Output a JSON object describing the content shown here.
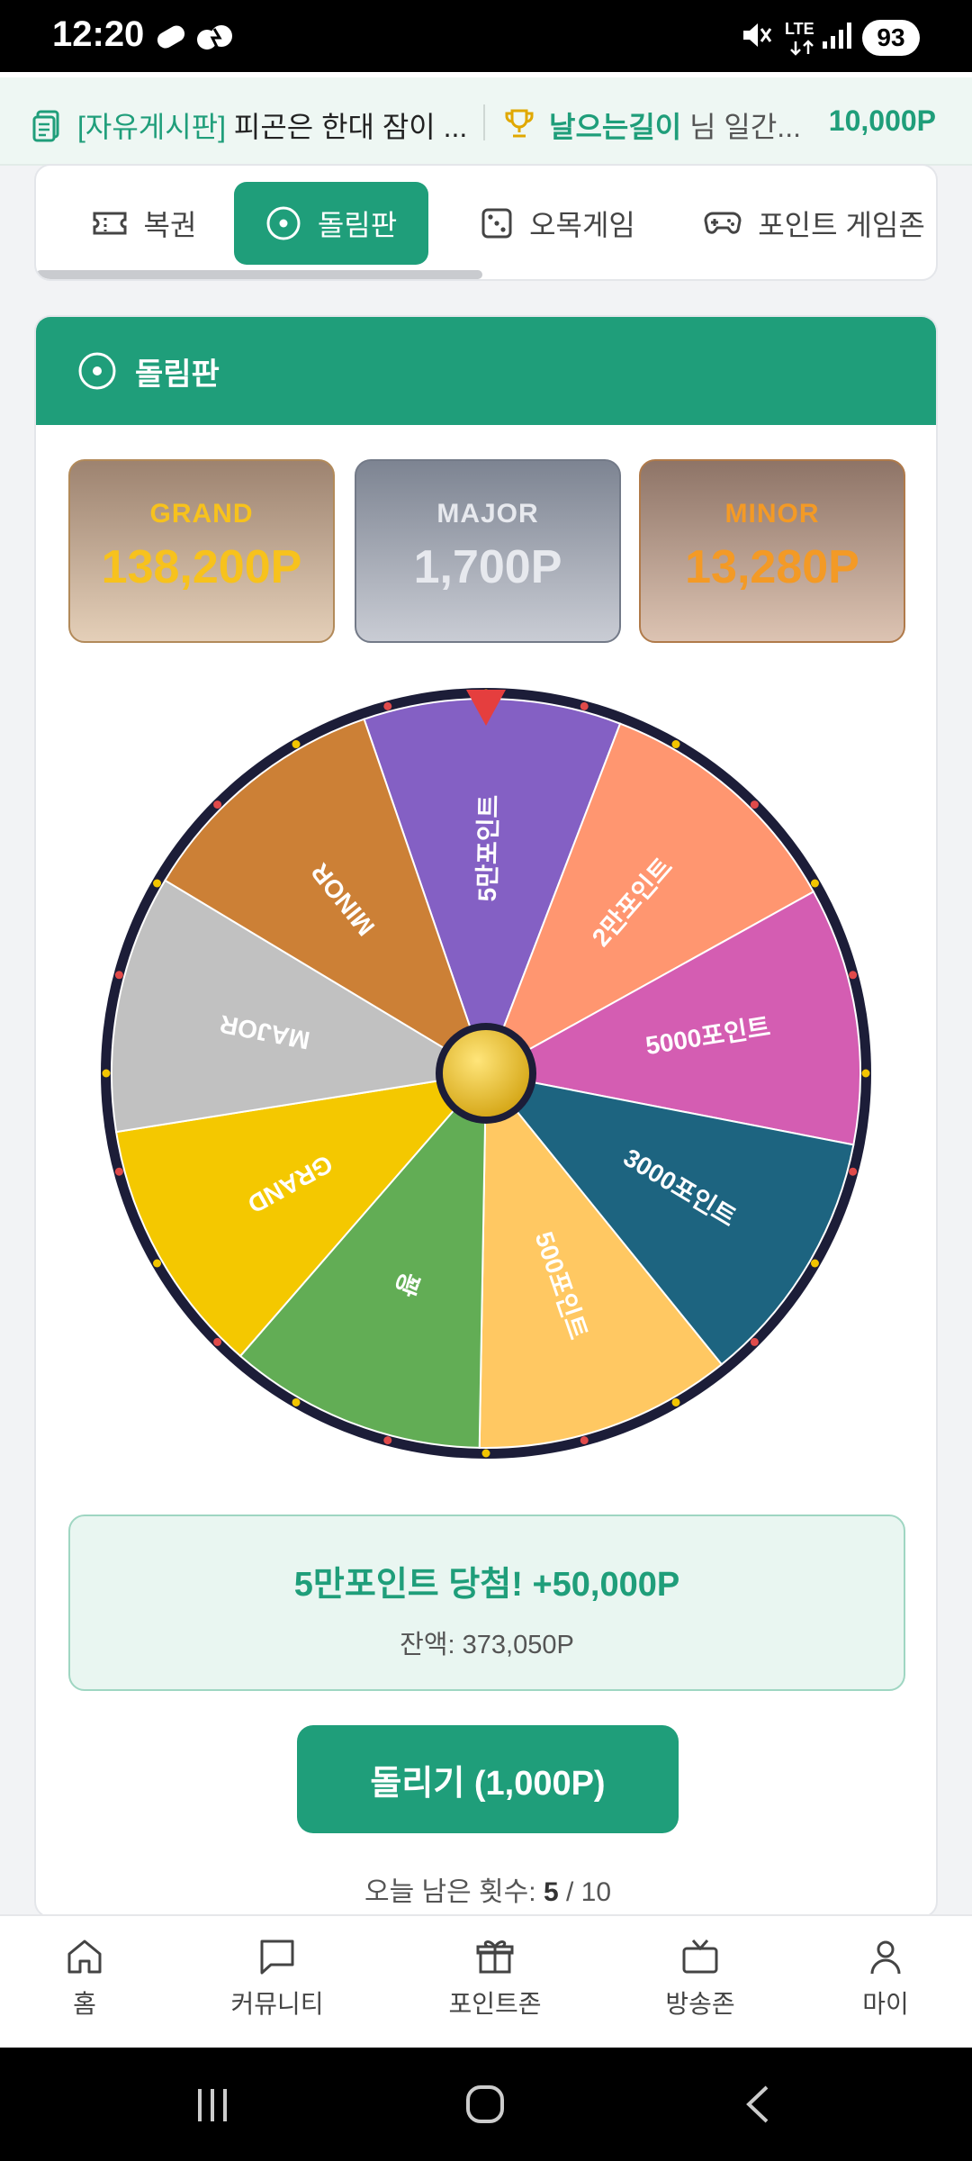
{
  "status": {
    "time": "12:20",
    "battery": "93",
    "network": "LTE"
  },
  "ticker": {
    "board": "[자유게시판]",
    "post": "피곤은 한대 잠이 ...",
    "nickname": "날으는길이",
    "suffix": "님 일간...",
    "points": "10,000P"
  },
  "tabs": [
    {
      "label": "복권",
      "icon": "ticket-icon",
      "active": false
    },
    {
      "label": "돌림판",
      "icon": "target-icon",
      "active": true
    },
    {
      "label": "오목게임",
      "icon": "dice-icon",
      "active": false
    },
    {
      "label": "포인트 게임존",
      "icon": "gamepad-icon",
      "active": false
    }
  ],
  "card": {
    "title": "돌림판"
  },
  "jackpots": [
    {
      "label": "GRAND",
      "value": "138,200P"
    },
    {
      "label": "MAJOR",
      "value": "1,700P"
    },
    {
      "label": "MINOR",
      "value": "13,280P"
    }
  ],
  "wheel": {
    "segments": [
      {
        "label": "5만포인트",
        "color": "#8460c4"
      },
      {
        "label": "2만포인트",
        "color": "#ff9670"
      },
      {
        "label": "5000포인트",
        "color": "#d45db2"
      },
      {
        "label": "3000포인트",
        "color": "#1d6480"
      },
      {
        "label": "500포인트",
        "color": "#ffc862"
      },
      {
        "label": "꽝",
        "color": "#62ad55"
      },
      {
        "label": "GRAND",
        "color": "#f4c800"
      },
      {
        "label": "MAJOR",
        "color": "#c1c1c1"
      },
      {
        "label": "MINOR",
        "color": "#cc8036"
      }
    ],
    "rim_color": "#1c1d38",
    "pointer_color": "#e53e3e",
    "hub_color": "#d4a514"
  },
  "result": {
    "title": "5만포인트 당첨! +50,000P",
    "balance": "잔액: 373,050P"
  },
  "spin_button": "돌리기 (1,000P)",
  "remaining": {
    "label": "오늘 남은 횟수:",
    "count": "5",
    "total": "/ 10"
  },
  "bottom_nav": [
    {
      "label": "홈",
      "icon": "home-icon"
    },
    {
      "label": "커뮤니티",
      "icon": "chat-icon"
    },
    {
      "label": "포인트존",
      "icon": "gift-icon"
    },
    {
      "label": "방송존",
      "icon": "tv-icon"
    },
    {
      "label": "마이",
      "icon": "user-icon"
    }
  ],
  "colors": {
    "primary": "#1f9e7a",
    "grand": "#f7c21d",
    "minor": "#f39a26"
  }
}
